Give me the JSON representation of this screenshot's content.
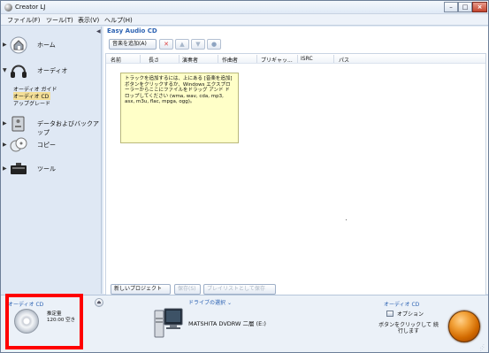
{
  "window": {
    "title": "Creator LJ",
    "controls": [
      "–",
      "□",
      "×"
    ]
  },
  "menu": [
    "ファイル(F)",
    "ツール(T)",
    "表示(V)",
    "ヘルプ(H)"
  ],
  "sidebar": {
    "collapse": "◀",
    "items": [
      {
        "label": "ホーム",
        "icon": "home-icon"
      },
      {
        "label": "オーディオ",
        "icon": "headphones-icon",
        "expanded": true,
        "children": [
          "オーディオ ガイド",
          "オーディオ CD",
          "アップグレード"
        ],
        "selected_child": "オーディオ CD"
      },
      {
        "label": "データおよびバックアップ",
        "icon": "data-backup-icon"
      },
      {
        "label": "コピー",
        "icon": "copy-icon"
      },
      {
        "label": "ツール",
        "icon": "tools-icon"
      }
    ]
  },
  "main": {
    "title": "Easy Audio CD",
    "add_music_label": "音楽を追加(A)",
    "icon_buttons": [
      "delete-icon",
      "move-up-icon",
      "move-down-icon",
      "info-icon"
    ],
    "columns": [
      "名前",
      "長さ",
      "演奏者",
      "作曲者",
      "プリギャッ...",
      "ISRC",
      "パス"
    ],
    "help_text": "トラックを追加するには、上にある [音楽を追加] ボタンをクリックするか、Windows エクスプローラーからここにファイルをドラッグ アンド ドロップしてください (wma, wav, cda, mp3, asx, m3u, flac, mpga, ogg)。",
    "new_project_label": "新しいプロジェクト(N)",
    "save_label": "保存(S)",
    "save_playlist_label": "プレイリストとして保存(P)"
  },
  "bottom": {
    "cd_title": "オーディオ CD",
    "capacity_label": "推定量",
    "capacity_value": "120:00 空き",
    "drive_select_label": "ドライブの選択",
    "drive_name": "MATSHITA DVDRW 二層 (E:)",
    "right_title": "オーディオ CD",
    "option_label": "オプション",
    "burn_hint": "ボタンをクリックして 続行します"
  },
  "colors": {
    "accent": "#2d63b3",
    "highlight": "#ff0000",
    "burn_button": "#d26a00"
  }
}
